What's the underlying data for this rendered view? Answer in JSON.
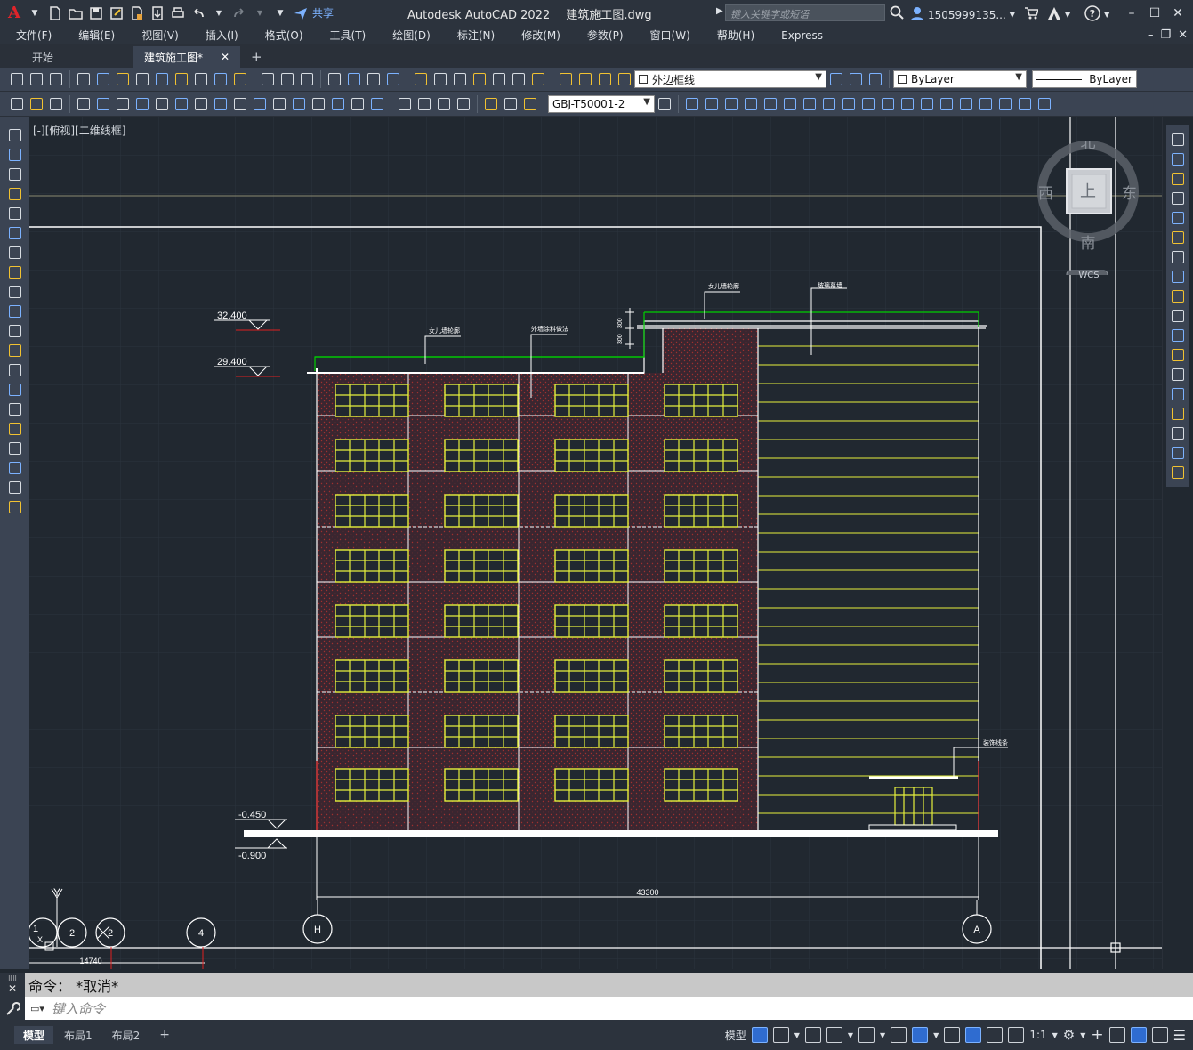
{
  "app": {
    "title": "Autodesk AutoCAD 2022",
    "filename": "建筑施工图.dwg",
    "share": "共享",
    "search_placeholder": "键入关键字或短语",
    "user": "1505999135...",
    "logo": "A"
  },
  "menu": [
    "文件(F)",
    "编辑(E)",
    "视图(V)",
    "插入(I)",
    "格式(O)",
    "工具(T)",
    "绘图(D)",
    "标注(N)",
    "修改(M)",
    "参数(P)",
    "窗口(W)",
    "帮助(H)",
    "Express"
  ],
  "tabs": {
    "start": "开始",
    "active": "建筑施工图*",
    "close": "✕",
    "add": "+"
  },
  "toolbar": {
    "layer_name": "外边框线",
    "color": "ByLayer",
    "linetype": "ByLayer",
    "block_name": "GBJ-T50001-2"
  },
  "viewport": {
    "label": "[-][俯视][二维线框]",
    "compass": {
      "north": "北",
      "south": "南",
      "east": "东",
      "west": "西",
      "top": "上",
      "wcs": "WCS"
    }
  },
  "drawing": {
    "levels": [
      "32.400",
      "29.400",
      "-0.450",
      "-0.900"
    ],
    "notes": [
      "女儿墙轮廓",
      "女儿墙轮廓",
      "外墙涂料做法",
      "玻璃幕墙",
      "装饰线条"
    ],
    "side_dims": [
      "300",
      "300"
    ],
    "overall_width": "43300",
    "axis_bubbles": [
      "H",
      "A"
    ],
    "left_bubbles": [
      "1",
      "2",
      "2",
      "4"
    ],
    "left_dim": "14740",
    "ucs_y": "Y",
    "ucs_x": "X"
  },
  "command": {
    "history": "命令：  *取消*",
    "prompt": "键入命令"
  },
  "layouts": [
    "模型",
    "布局1",
    "布局2"
  ],
  "status": {
    "model": "模型",
    "scale": "1:1"
  },
  "colors": {
    "background": "#212830",
    "wall": "#ffffff",
    "window": "#e6f03c",
    "parapet": "#00d000",
    "accent": "#2f6cd0"
  }
}
